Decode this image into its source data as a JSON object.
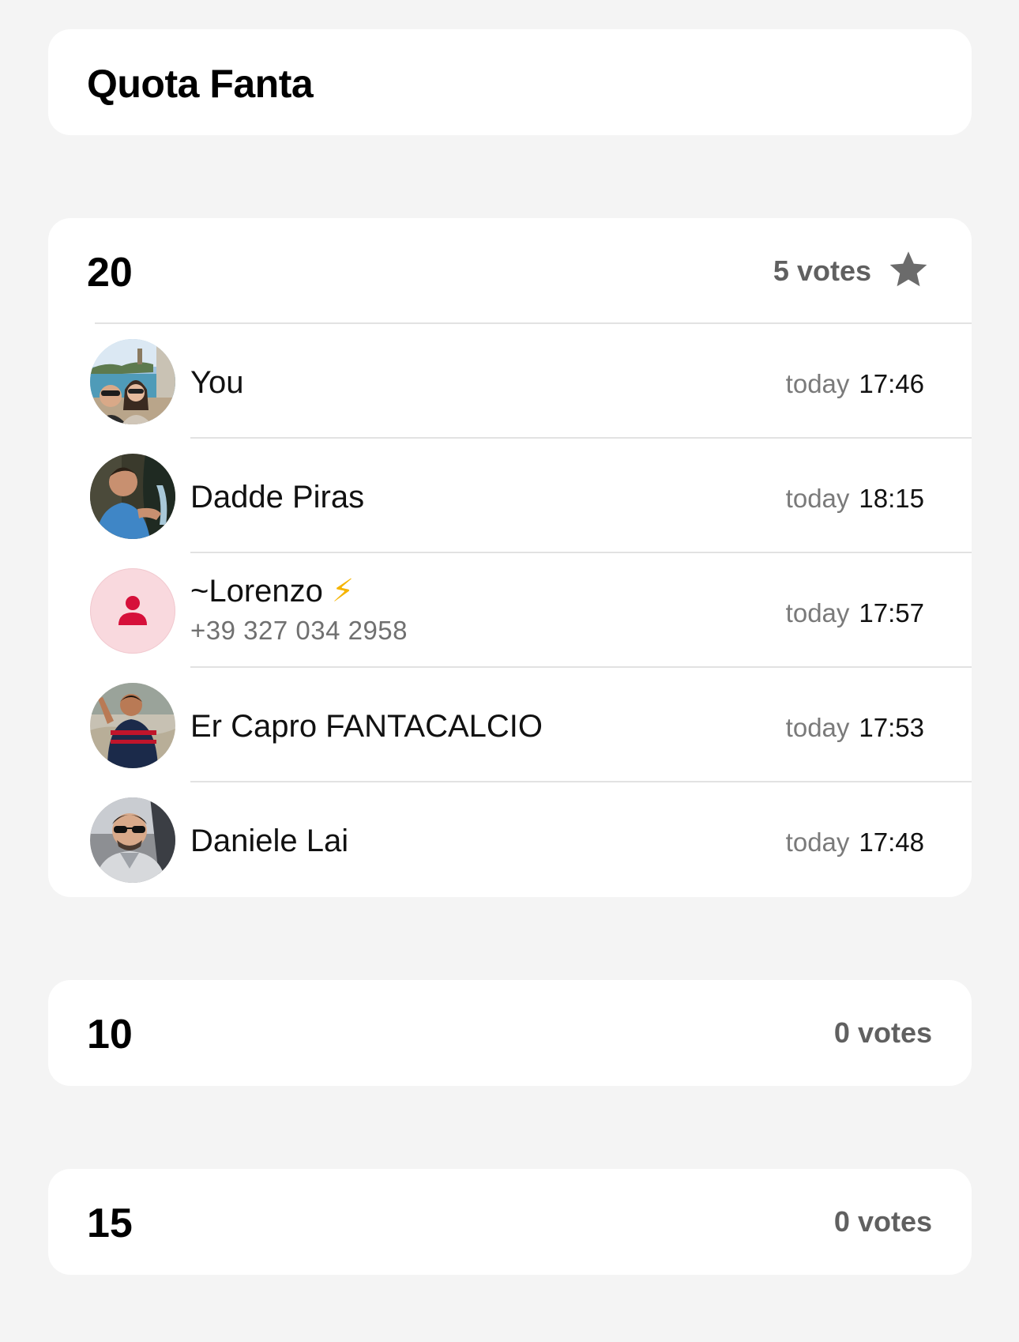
{
  "poll": {
    "title": "Quota Fanta",
    "options": [
      {
        "label": "20",
        "votes_text": "5 votes",
        "voters": [
          {
            "name": "You",
            "day": "today",
            "time": "17:46",
            "avatar": "photo-couple-lake"
          },
          {
            "name": "Dadde Piras",
            "day": "today",
            "time": "18:15",
            "avatar": "photo-boy-cliff"
          },
          {
            "name": "~Lorenzo",
            "emoji": "⚡",
            "phone": "+39 327 034 2958",
            "day": "today",
            "time": "17:57",
            "avatar": "person-placeholder-icon"
          },
          {
            "name": "Er Capro FANTACALCIO",
            "day": "today",
            "time": "17:53",
            "avatar": "photo-man-jersey"
          },
          {
            "name": "Daniele Lai",
            "day": "today",
            "time": "17:48",
            "avatar": "photo-man-sunglasses"
          }
        ]
      },
      {
        "label": "10",
        "votes_text": "0 votes"
      },
      {
        "label": "15",
        "votes_text": "0 votes"
      }
    ]
  },
  "colors": {
    "background": "#f4f4f4",
    "card": "#ffffff",
    "secondary_text": "#606060",
    "placeholder_avatar_bg": "#f9d9de",
    "placeholder_avatar_fg": "#d6103a"
  },
  "icons": {
    "winner": "star-icon",
    "placeholder": "person-placeholder-icon"
  }
}
